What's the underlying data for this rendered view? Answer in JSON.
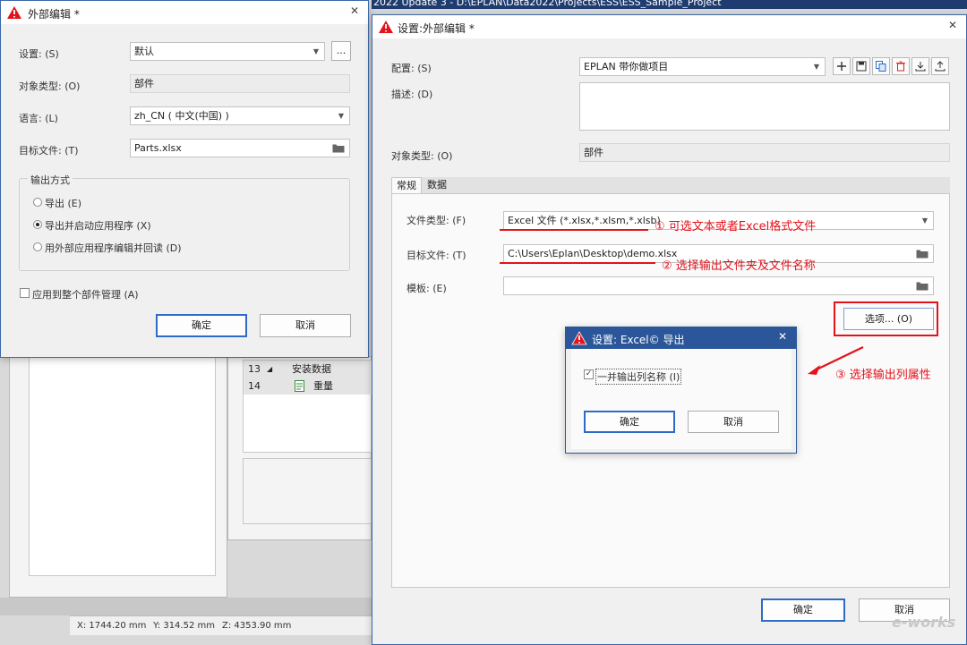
{
  "background": {
    "title_text": "2022 Update 3 - D:\\EPLAN\\Data2022\\Projects\\ESS\\ESS_Sample_Project",
    "tree_rows": [
      {
        "num": "13",
        "label": "安装数据"
      },
      {
        "num": "14",
        "label": "重量"
      }
    ],
    "status": {
      "x": "X:  1744.20 mm",
      "y": "Y:  314.52 mm",
      "z": "Z:  4353.90 mm"
    }
  },
  "dialog_left": {
    "title": "外部编辑 *",
    "settings_label": "设置: (S)",
    "settings_value": "默认",
    "more_label": "...",
    "object_type_label": "对象类型: (O)",
    "object_type_value": "部件",
    "language_label": "语言: (L)",
    "language_value": "zh_CN ( 中文(中国) )",
    "target_label": "目标文件: (T)",
    "target_value": "Parts.xlsx",
    "output_group_label": "输出方式",
    "radios": [
      {
        "label": "导出 (E)",
        "selected": false
      },
      {
        "label": "导出并启动应用程序 (X)",
        "selected": true
      },
      {
        "label": "用外部应用程序编辑并回读 (D)",
        "selected": false
      }
    ],
    "apply_all_label": "应用到整个部件管理 (A)",
    "ok_label": "确定",
    "cancel_label": "取消"
  },
  "dialog_right": {
    "title": "设置:外部编辑 *",
    "config_label": "配置: (S)",
    "config_value": "EPLAN 带你做项目",
    "desc_label": "描述: (D)",
    "object_type_label": "对象类型: (O)",
    "object_type_value": "部件",
    "tabs": [
      {
        "label": "常规",
        "active": true
      },
      {
        "label": "数据",
        "active": false
      }
    ],
    "file_type_label": "文件类型: (F)",
    "file_type_value": "Excel 文件 (*.xlsx,*.xlsm,*.xlsb)",
    "target_label": "目标文件: (T)",
    "target_value": "C:\\Users\\Eplan\\Desktop\\demo.xlsx",
    "template_label": "模板: (E)",
    "template_value": "",
    "options_button": "选项... (O)",
    "ok_label": "确定",
    "cancel_label": "取消",
    "toolbar_icons": [
      "plus-icon",
      "save-icon",
      "copy-icon",
      "delete-icon",
      "import-icon",
      "export-icon"
    ]
  },
  "dialog_excel": {
    "title": "设置: Excel© 导出",
    "checkbox_label": "一并输出列名称 (I)",
    "checkbox_checked": true,
    "ok_label": "确定",
    "cancel_label": "取消"
  },
  "annotations": {
    "a1": "① 可选文本或者Excel格式文件",
    "a2": "② 选择输出文件夹及文件名称",
    "a3": "③ 选择输出列属性",
    "color": "#e3121b"
  },
  "watermark": "e-works"
}
